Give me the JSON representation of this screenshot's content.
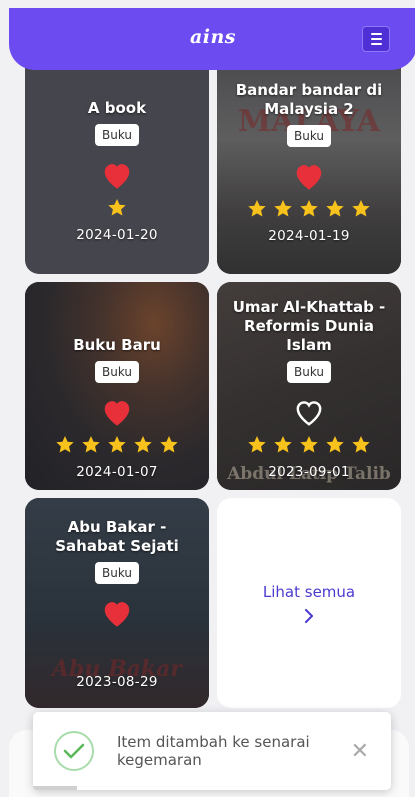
{
  "header": {
    "logo": "ains",
    "menu_icon": "hamburger-icon",
    "color": "#6c4cf1"
  },
  "cards": [
    {
      "title": "A book",
      "badge": "Buku",
      "favorited": true,
      "rating": 1,
      "date": "2024-01-20"
    },
    {
      "title": "Bandar bandar di Malaysia 2",
      "badge": "Buku",
      "favorited": true,
      "rating": 5,
      "date": "2024-01-19",
      "cover_text": "MALAYA"
    },
    {
      "title": "Buku Baru",
      "badge": "Buku",
      "favorited": true,
      "rating": 5,
      "date": "2024-01-07"
    },
    {
      "title": "Umar Al-Khattab - Reformis Dunia Islam",
      "badge": "Buku",
      "favorited": false,
      "rating": 5,
      "date": "2023-09-01",
      "cover_text": "Abdul Latip Talib"
    },
    {
      "title": "Abu Bakar - Sahabat Sejati",
      "badge": "Buku",
      "favorited": true,
      "rating": 0,
      "date": "2023-08-29",
      "cover_text": "Abu Bakar"
    }
  ],
  "view_all": {
    "label": "Lihat semua",
    "icon": "chevron-right-icon"
  },
  "toast": {
    "message": "Item ditambah ke senarai kegemaran",
    "icon": "check-circle-icon",
    "close_icon": "close-icon"
  },
  "colors": {
    "heart": "#e8303a",
    "star": "#f7c21b",
    "accent": "#4c3bd1"
  }
}
